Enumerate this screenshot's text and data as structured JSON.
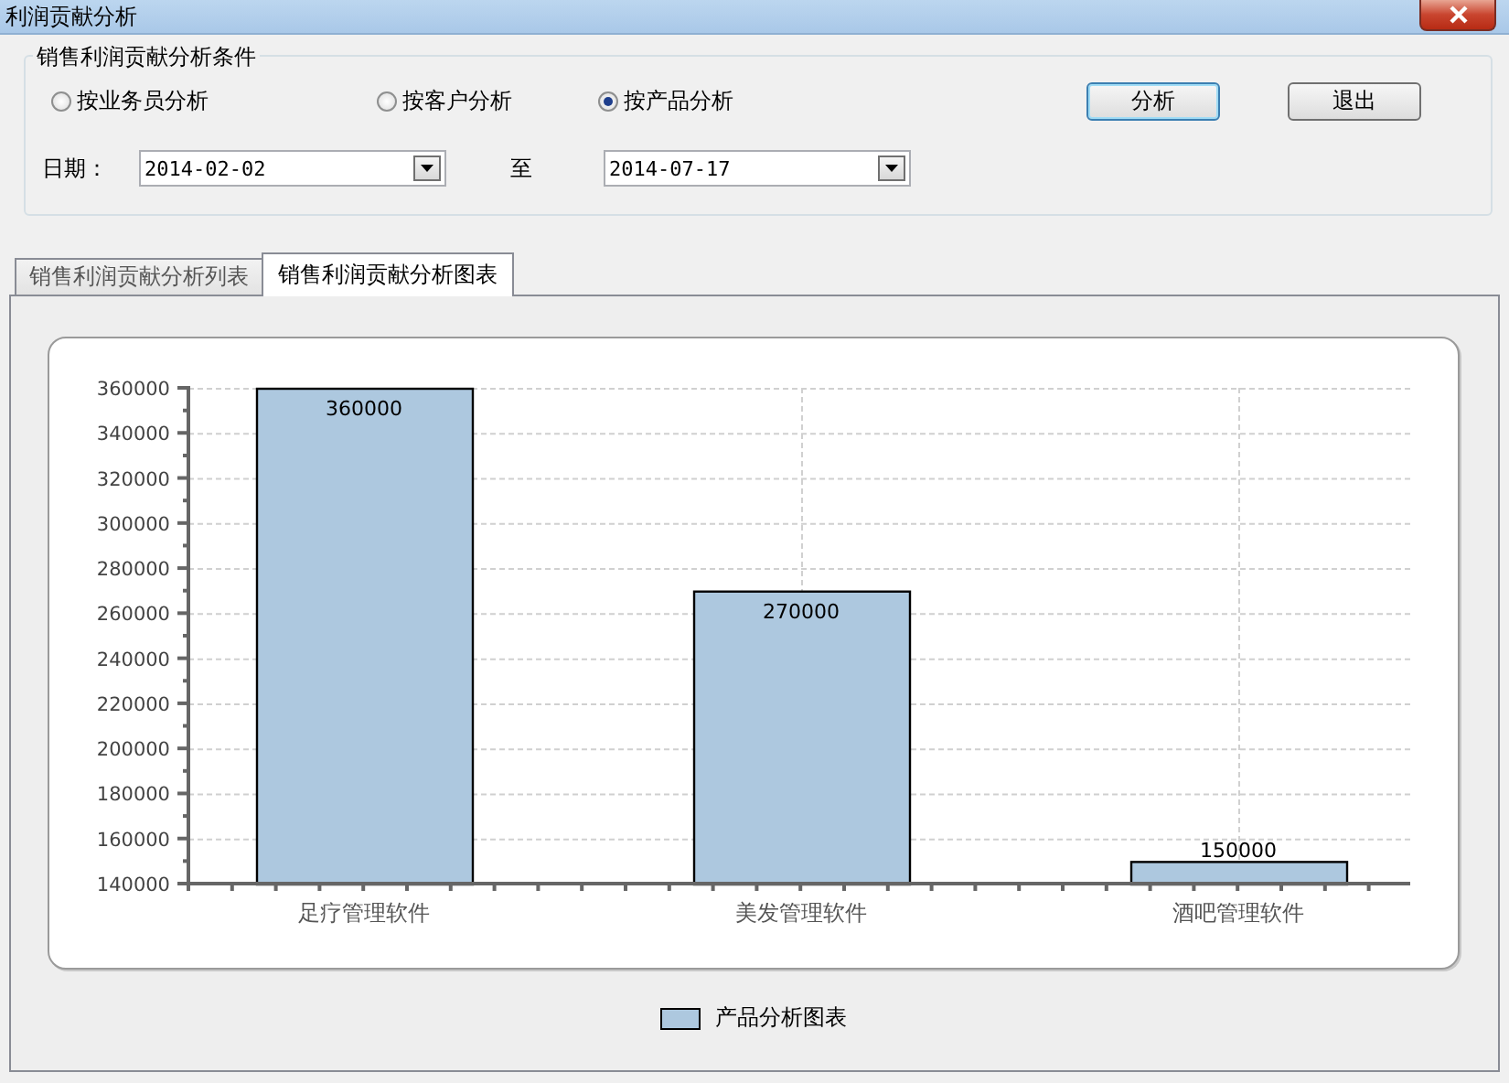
{
  "window": {
    "title": "利润贡献分析"
  },
  "conditions": {
    "title": "销售利润贡献分析条件",
    "modes": [
      {
        "label": "按业务员分析",
        "selected": false
      },
      {
        "label": "按客户分析",
        "selected": false
      },
      {
        "label": "按产品分析",
        "selected": true
      }
    ],
    "buttons": [
      {
        "label": "分析",
        "default": true
      },
      {
        "label": "退出",
        "default": false
      }
    ],
    "date_label": "日期：",
    "date_from": "2014-02-02",
    "date_separator": "至",
    "date_to": "2014-07-17"
  },
  "tabs": [
    {
      "label": "销售利润贡献分析列表",
      "selected": false
    },
    {
      "label": "销售利润贡献分析图表",
      "selected": true
    }
  ],
  "chart": {
    "chart_data": {
      "type": "bar",
      "categories": [
        "足疗管理软件",
        "美发管理软件",
        "酒吧管理软件"
      ],
      "series": [
        {
          "name": "产品分析图表",
          "color": "#adc8df",
          "values": [
            360000,
            270000,
            150000
          ]
        }
      ],
      "ylim": [
        140000,
        360000
      ],
      "yticks": [
        140000,
        160000,
        180000,
        200000,
        220000,
        240000,
        260000,
        280000,
        300000,
        320000,
        340000,
        360000
      ],
      "data_labels": true,
      "grid": true
    }
  }
}
